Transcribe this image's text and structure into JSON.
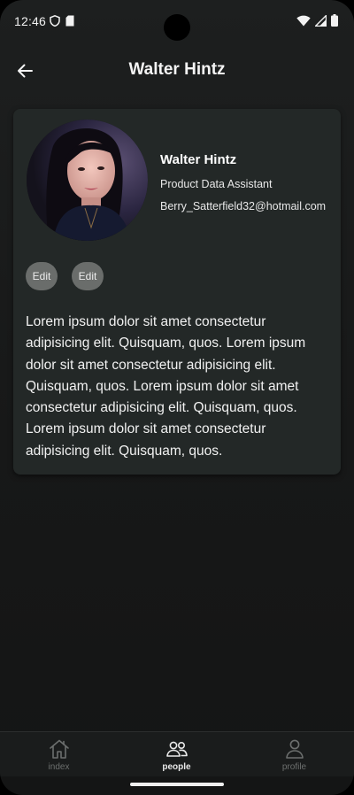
{
  "status_bar": {
    "time": "12:46"
  },
  "app_bar": {
    "title": "Walter Hintz"
  },
  "profile": {
    "name": "Walter Hintz",
    "job_title": "Product Data Assistant",
    "email": "Berry_Satterfield32@hotmail.com",
    "edit_buttons": [
      "Edit",
      "Edit"
    ],
    "bio": "Lorem ipsum dolor sit amet consectetur adipisicing elit. Quisquam, quos. Lorem ipsum dolor sit amet consectetur adipisicing elit. Quisquam, quos. Lorem ipsum dolor sit amet consectetur adipisicing elit. Quisquam, quos. Lorem ipsum dolor sit amet consectetur adipisicing elit. Quisquam, quos."
  },
  "bottom_nav": {
    "items": [
      {
        "label": "index",
        "icon": "home-icon",
        "active": false
      },
      {
        "label": "people",
        "icon": "people-icon",
        "active": true
      },
      {
        "label": "profile",
        "icon": "person-icon",
        "active": false
      }
    ]
  },
  "colors": {
    "background": "#1a1c1c",
    "card": "#232827",
    "edit_button": "#6a6d6b",
    "active_nav": "#e9e9e9",
    "inactive_nav": "#6c6f6e"
  }
}
